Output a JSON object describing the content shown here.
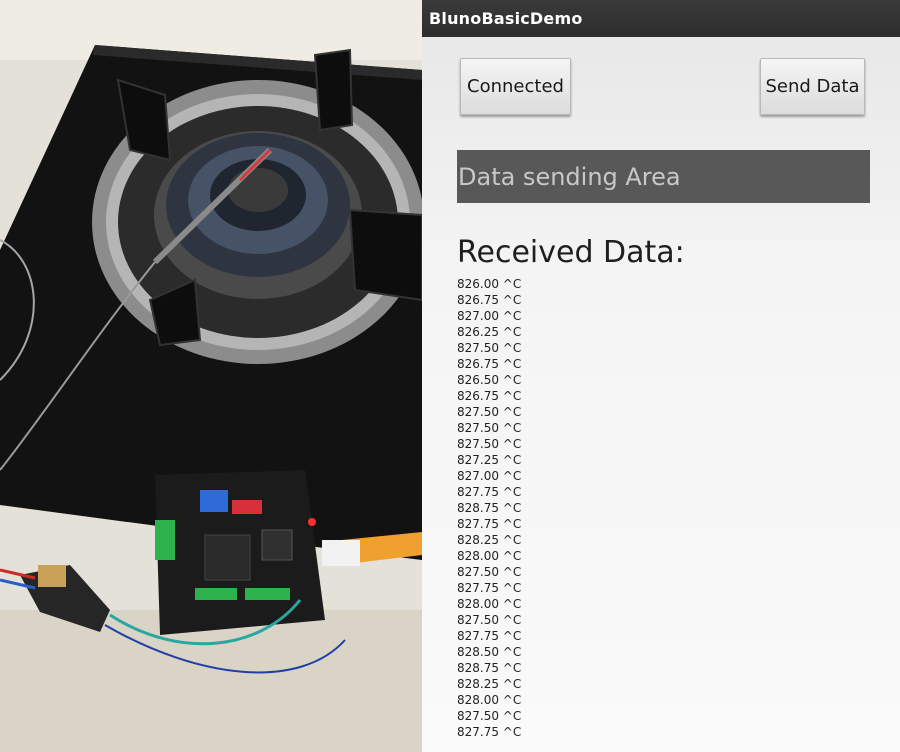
{
  "app": {
    "title": "BlunoBasicDemo",
    "connect_button": "Connected",
    "send_button": "Send Data",
    "send_placeholder": "Data sending Area",
    "received_label": "Received Data:"
  },
  "received_readings": [
    "826.00 ^C",
    "826.75 ^C",
    "827.00 ^C",
    "826.25 ^C",
    "827.50 ^C",
    "826.75 ^C",
    "826.50 ^C",
    "826.75 ^C",
    "827.50 ^C",
    "827.50 ^C",
    "827.50 ^C",
    "827.25 ^C",
    "827.00 ^C",
    "827.75 ^C",
    "828.75 ^C",
    "827.75 ^C",
    "828.25 ^C",
    "828.00 ^C",
    "827.50 ^C",
    "827.75 ^C",
    "828.00 ^C",
    "827.50 ^C",
    "827.75 ^C",
    "828.50 ^C",
    "828.75 ^C",
    "828.25 ^C",
    "828.00 ^C",
    "827.50 ^C",
    "827.75 ^C"
  ],
  "photo": {
    "icon": "stove-thermocouple-photo",
    "colors": {
      "counter": "#e9e6dd",
      "stove": "#141414",
      "ring": "#9a9a9a",
      "board": "#1b1b1b",
      "ribbon": "#f0a030"
    }
  }
}
